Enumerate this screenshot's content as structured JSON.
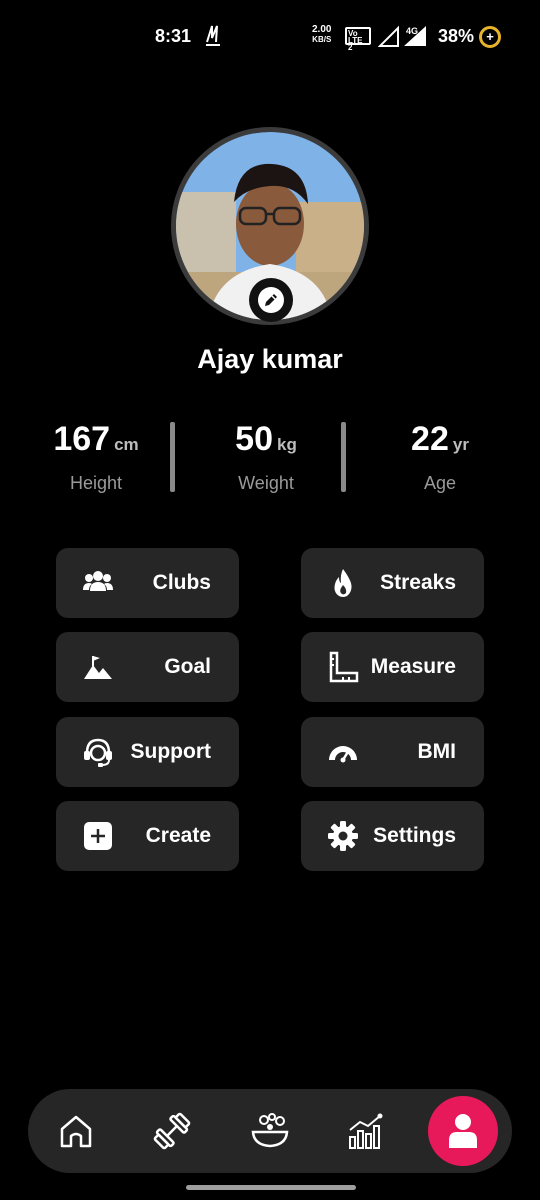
{
  "status_bar": {
    "time": "8:31",
    "net_speed_top": "2.00",
    "net_speed_bottom": "KB/S",
    "volte_top": "Vo",
    "volte_bottom": "LTE 2",
    "network_type": "4G",
    "battery": "38%",
    "battery_icon": "battery-saver-icon"
  },
  "profile": {
    "name": "Ajay kumar",
    "edit_icon": "edit-icon"
  },
  "stats": [
    {
      "value": "167",
      "unit": "cm",
      "label": "Height"
    },
    {
      "value": "50",
      "unit": "kg",
      "label": "Weight"
    },
    {
      "value": "22",
      "unit": "yr",
      "label": "Age"
    }
  ],
  "menu": {
    "clubs": {
      "label": "Clubs",
      "icon": "group-icon"
    },
    "streaks": {
      "label": "Streaks",
      "icon": "flame-icon"
    },
    "goal": {
      "label": "Goal",
      "icon": "mountain-flag-icon"
    },
    "measure": {
      "label": "Measure",
      "icon": "ruler-icon"
    },
    "support": {
      "label": "Support",
      "icon": "headset-icon"
    },
    "bmi": {
      "label": "BMI",
      "icon": "gauge-icon"
    },
    "create": {
      "label": "Create",
      "icon": "plus-square-icon"
    },
    "settings": {
      "label": "Settings",
      "icon": "gear-icon"
    }
  },
  "bottom_nav": [
    {
      "id": "home",
      "icon": "home-icon"
    },
    {
      "id": "workout",
      "icon": "dumbbell-icon"
    },
    {
      "id": "diet",
      "icon": "food-bowl-icon"
    },
    {
      "id": "progress",
      "icon": "bar-chart-icon"
    },
    {
      "id": "profile",
      "icon": "user-icon",
      "active": true
    }
  ],
  "colors": {
    "background": "#000000",
    "card": "#262626",
    "accent": "#e8195b",
    "muted_text": "#9a9a9a"
  }
}
